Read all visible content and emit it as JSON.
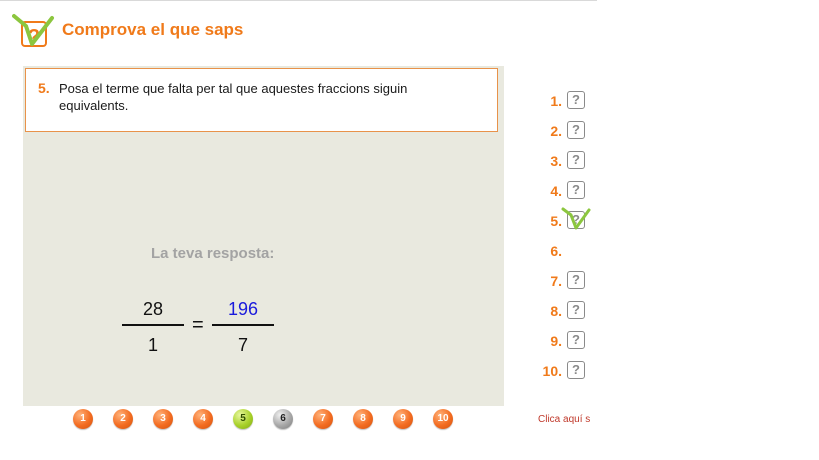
{
  "header": {
    "title": "Comprova el que saps",
    "logo_icon": "question-check-icon"
  },
  "question": {
    "number": "5.",
    "text": "Posa el terme que falta per tal que aquestes fraccions siguin equivalents."
  },
  "answer": {
    "label": "La teva resposta:",
    "left_fraction": {
      "numerator": "28",
      "denominator": "1"
    },
    "equals": "=",
    "right_fraction": {
      "numerator": "196",
      "denominator": "7"
    }
  },
  "question_list": [
    {
      "label": "1.",
      "status": "pending"
    },
    {
      "label": "2.",
      "status": "pending"
    },
    {
      "label": "3.",
      "status": "pending"
    },
    {
      "label": "4.",
      "status": "pending"
    },
    {
      "label": "5.",
      "status": "checked"
    },
    {
      "label": "6.",
      "status": "empty"
    },
    {
      "label": "7.",
      "status": "pending"
    },
    {
      "label": "8.",
      "status": "pending"
    },
    {
      "label": "9.",
      "status": "pending"
    },
    {
      "label": "10.",
      "status": "pending"
    }
  ],
  "pending_mark": "?",
  "nav_buttons": [
    {
      "label": "1",
      "state": "normal"
    },
    {
      "label": "2",
      "state": "normal"
    },
    {
      "label": "3",
      "state": "normal"
    },
    {
      "label": "4",
      "state": "normal"
    },
    {
      "label": "5",
      "state": "current"
    },
    {
      "label": "6",
      "state": "done"
    },
    {
      "label": "7",
      "state": "normal"
    },
    {
      "label": "8",
      "state": "normal"
    },
    {
      "label": "9",
      "state": "normal"
    },
    {
      "label": "10",
      "state": "normal"
    }
  ],
  "footer_link": "Clica aquí s",
  "colors": {
    "accent": "#f07a1a",
    "panel": "#e9e9df",
    "answer_blue": "#1a1adc",
    "check_green": "#8cc63f"
  }
}
